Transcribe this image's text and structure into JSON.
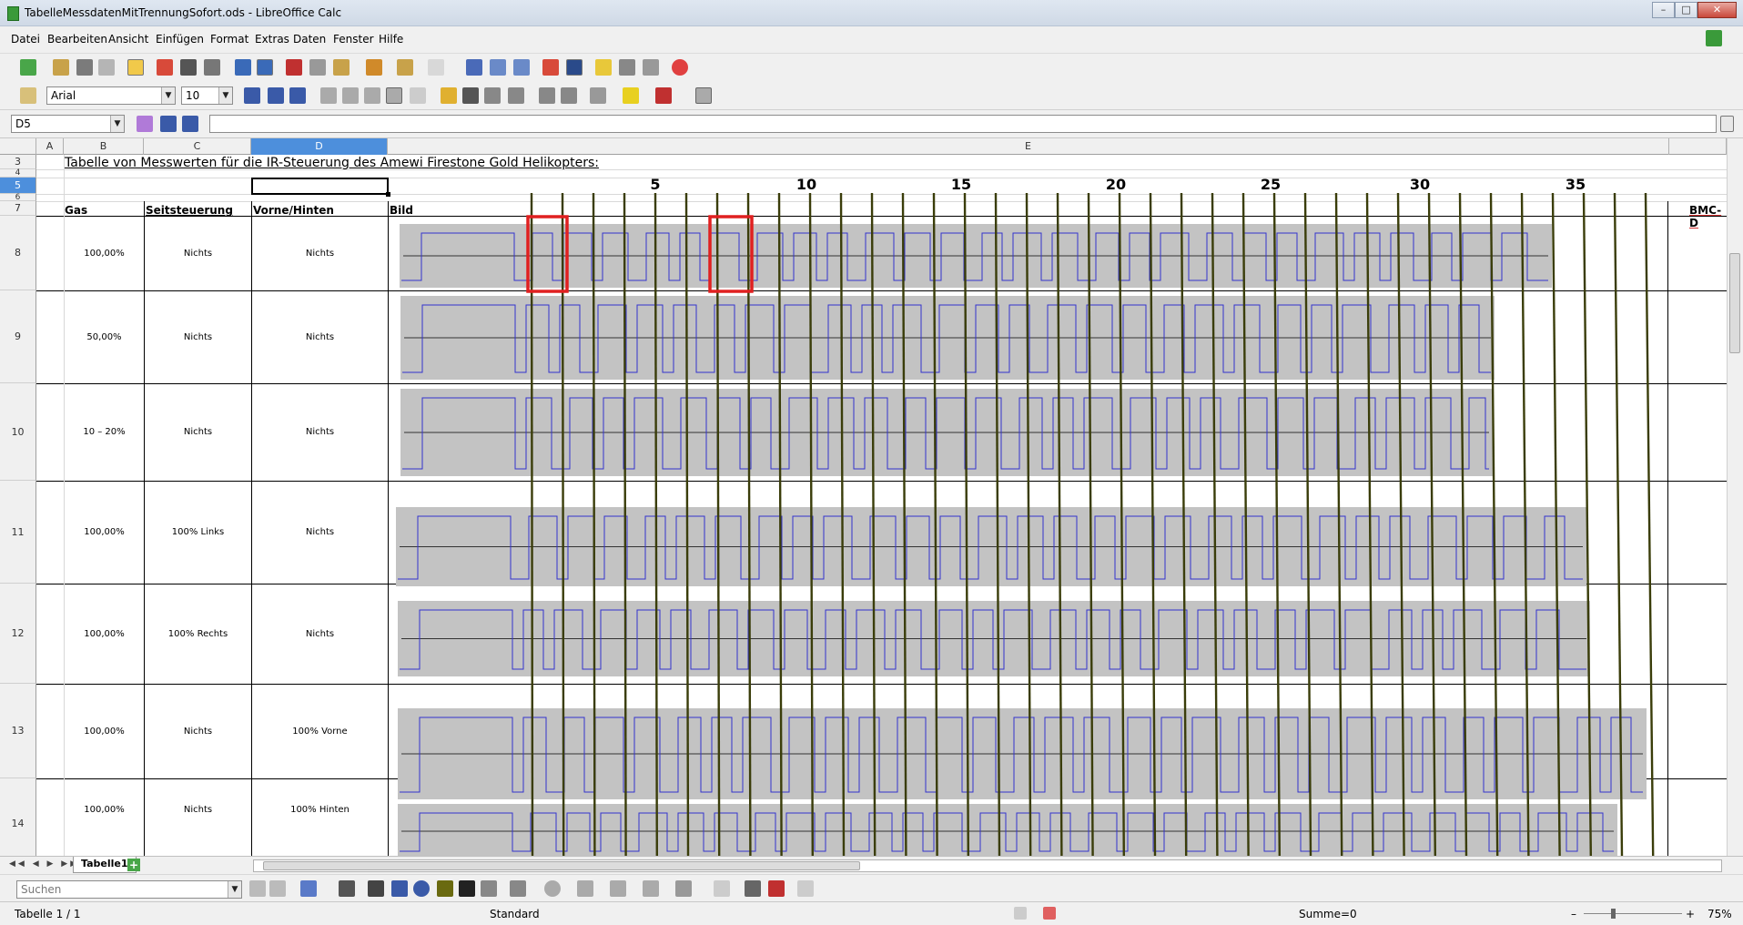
{
  "window": {
    "title": "TabelleMessdatenMitTrennungSofort.ods - LibreOffice Calc",
    "minimize": "–",
    "maximize": "□",
    "close": "✕"
  },
  "menu": [
    "Datei",
    "Bearbeiten",
    "Ansicht",
    "Einfügen",
    "Format",
    "Extras",
    "Daten",
    "Fenster",
    "Hilfe"
  ],
  "formatting": {
    "font_name": "Arial",
    "font_size": "10"
  },
  "formula_bar": {
    "cell_ref": "D5",
    "content": ""
  },
  "columns": [
    "A",
    "B",
    "C",
    "D",
    "E"
  ],
  "active_column": "D",
  "sheet": {
    "title": "Tabelle von Messwerten für die IR-Steuerung des Amewi Firestone Gold Helikopters:",
    "header_labels": {
      "gas": "Gas",
      "seitsteuerung": "Seitsteuerung",
      "vorne_hinten": "Vorne/Hinten",
      "bild": "Bild",
      "bmc": "BMC-D"
    },
    "marker_numbers": [
      "5",
      "10",
      "15",
      "20",
      "25",
      "30",
      "35"
    ],
    "rows": [
      {
        "num": "3"
      },
      {
        "num": "4"
      },
      {
        "num": "5"
      },
      {
        "num": "6"
      },
      {
        "num": "7"
      },
      {
        "num": "8",
        "gas": "100,00%",
        "seit": "Nichts",
        "vorne": "Nichts"
      },
      {
        "num": "9",
        "gas": "50,00%",
        "seit": "Nichts",
        "vorne": "Nichts"
      },
      {
        "num": "10",
        "gas": "10 – 20%",
        "seit": "Nichts",
        "vorne": "Nichts"
      },
      {
        "num": "11",
        "gas": "100,00%",
        "seit": "100% Links",
        "vorne": "Nichts"
      },
      {
        "num": "12",
        "gas": "100,00%",
        "seit": "100% Rechts",
        "vorne": "Nichts"
      },
      {
        "num": "13",
        "gas": "100,00%",
        "seit": "Nichts",
        "vorne": "100% Vorne"
      },
      {
        "num": "14",
        "gas": "100,00%",
        "seit": "Nichts",
        "vorne": "100% Hinten"
      }
    ]
  },
  "sheet_tab": "Tabelle1",
  "search": {
    "placeholder": "Suchen"
  },
  "status": {
    "sheet": "Tabelle 1 / 1",
    "style": "Standard",
    "sum": "Summe=0",
    "zoom": "75%"
  },
  "colors": {
    "signal_bg": "#c3c3c3",
    "signal_line": "#3333cc",
    "marker_line": "#3a3d0a",
    "highlight": "#e02020",
    "selection": "#4d8fdc"
  }
}
